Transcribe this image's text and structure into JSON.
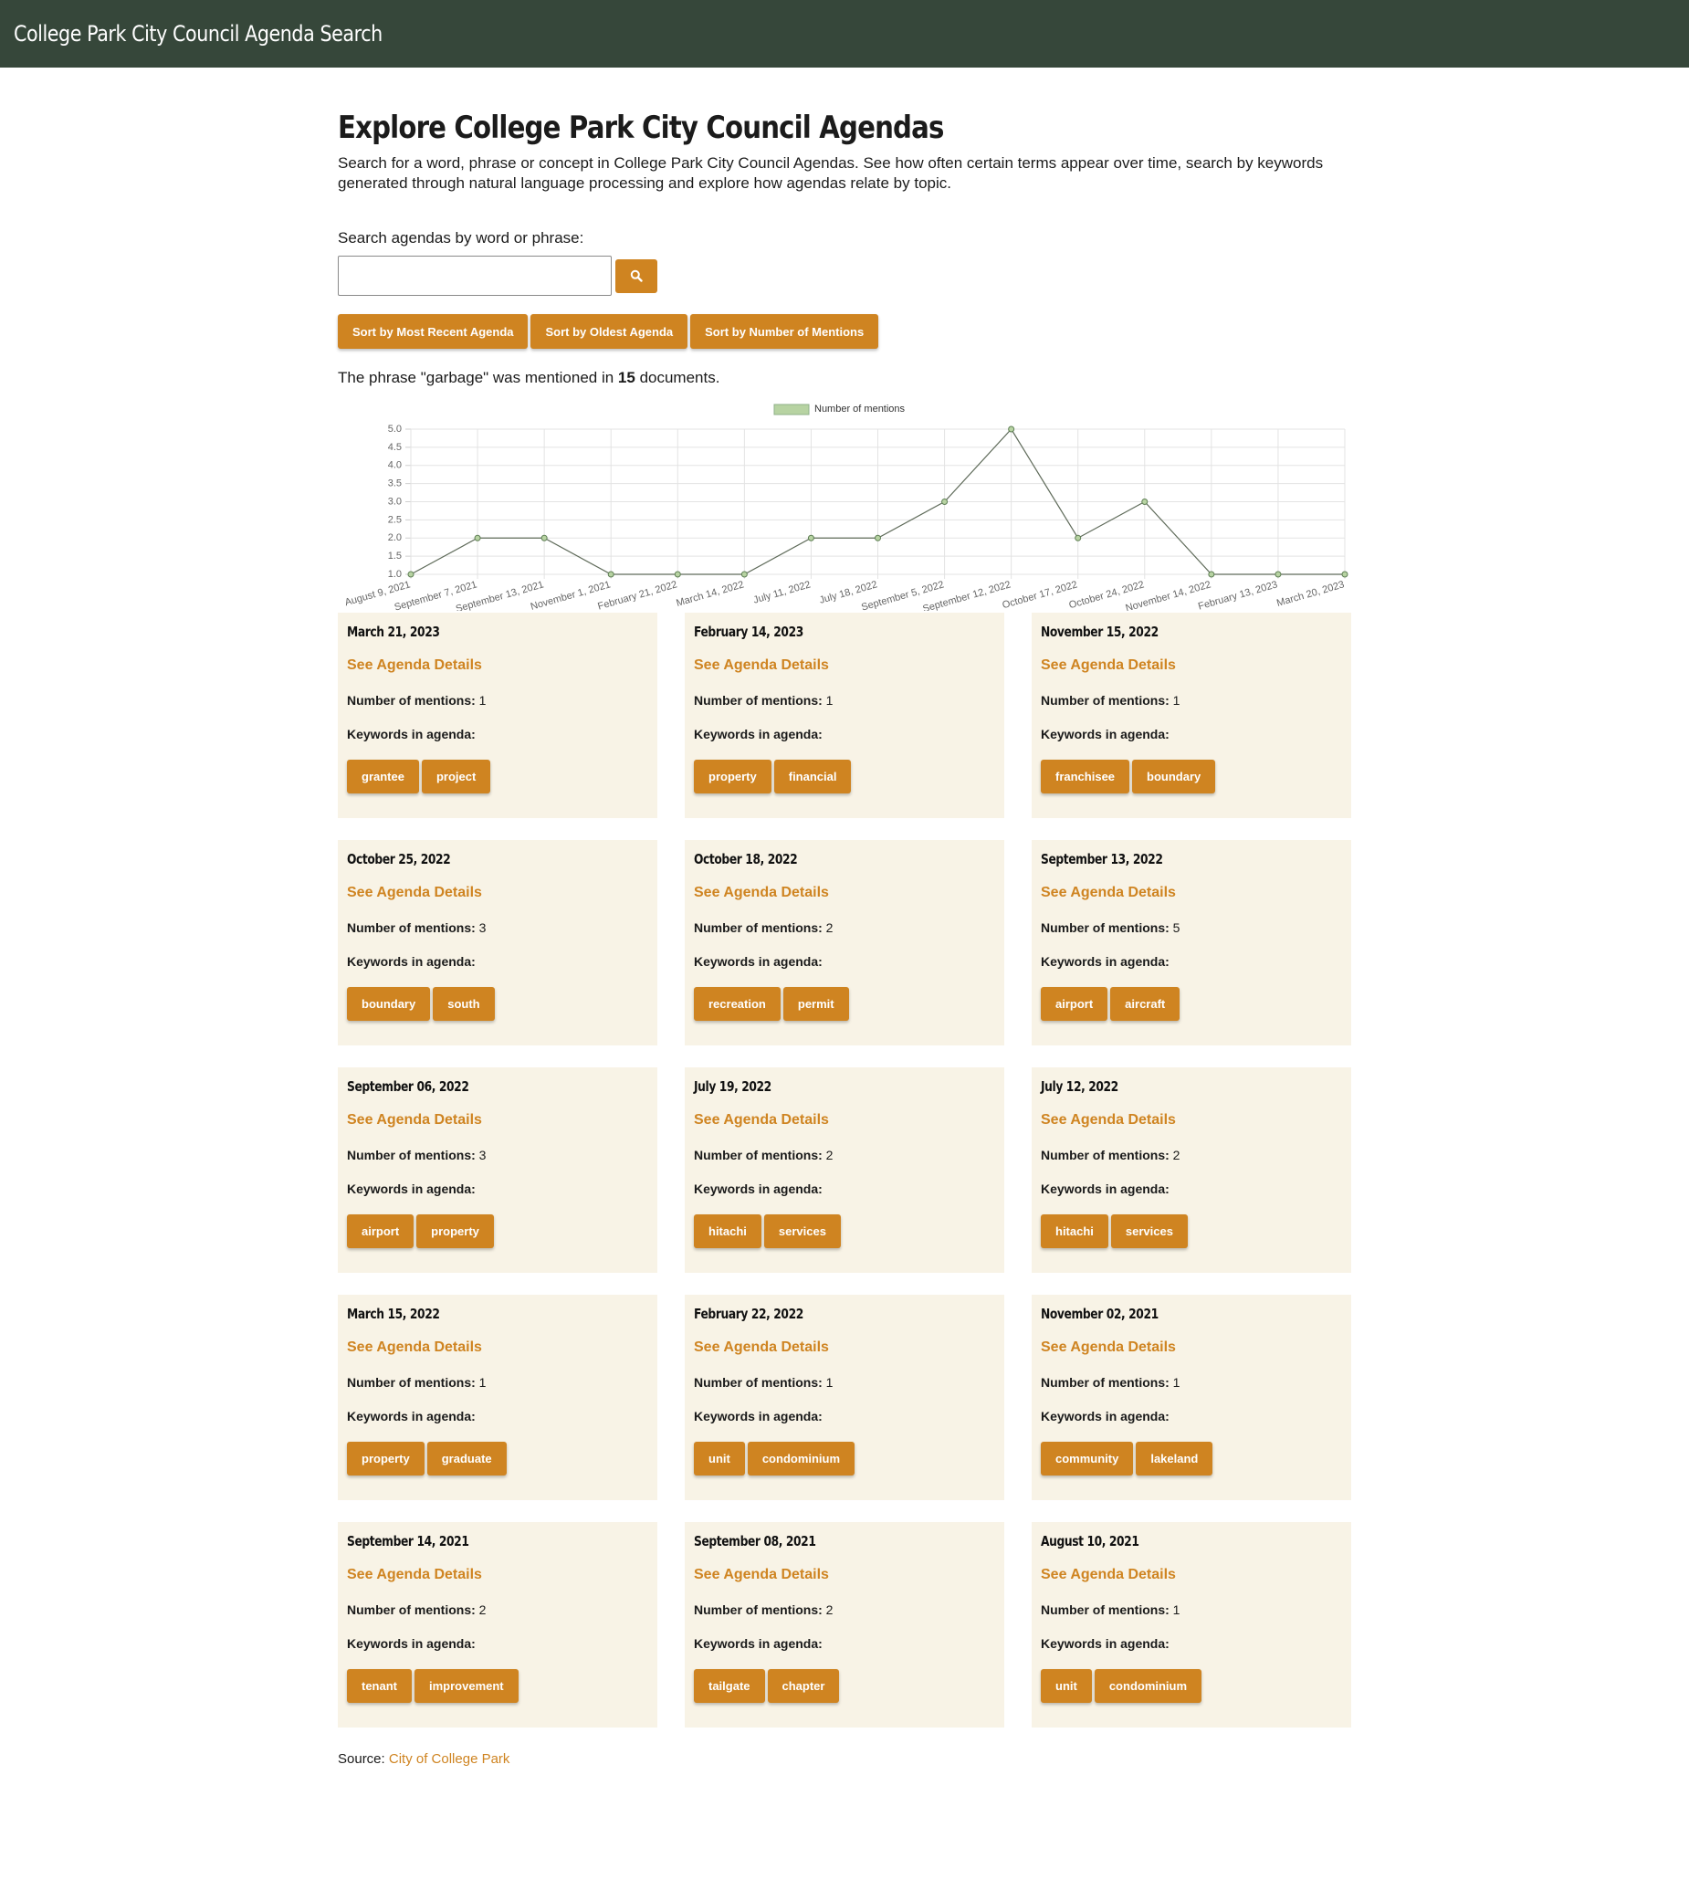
{
  "header": {
    "title": "College Park City Council Agenda Search"
  },
  "main": {
    "title": "Explore College Park City Council Agendas",
    "intro": "Search for a word, phrase or concept in College Park City Council Agendas. See how often certain terms appear over time, search by keywords generated through natural language processing and explore how agendas relate by topic.",
    "search": {
      "label": "Search agendas by word or phrase:",
      "value": "",
      "button_icon": "search-icon"
    },
    "sort_buttons": [
      "Sort by Most Recent Agenda",
      "Sort by Oldest Agenda",
      "Sort by Number of Mentions"
    ],
    "summary": {
      "prefix": "The phrase \"garbage\" was mentioned in ",
      "count": "15",
      "suffix": " documents."
    }
  },
  "colors": {
    "accent": "#cf8421",
    "header_bg": "#36473a",
    "card_bg": "#f8f3e6",
    "legend_fill": "#b7d3a2",
    "line": "#5f6b5a"
  },
  "chart_data": {
    "type": "line",
    "legend": "Number of mentions",
    "legend_position": "top",
    "grid": true,
    "ylim": [
      1.0,
      5.0
    ],
    "yticks": [
      "1.0",
      "1.5",
      "2.0",
      "2.5",
      "3.0",
      "3.5",
      "4.0",
      "4.5",
      "5.0"
    ],
    "x": [
      "August 9, 2021",
      "September 7, 2021",
      "September 13, 2021",
      "November 1, 2021",
      "February 21, 2022",
      "March 14, 2022",
      "July 11, 2022",
      "July 18, 2022",
      "September 5, 2022",
      "September 12, 2022",
      "October 17, 2022",
      "October 24, 2022",
      "November 14, 2022",
      "February 13, 2023",
      "March 20, 2023"
    ],
    "series": [
      {
        "name": "Number of mentions",
        "values": [
          1,
          2,
          2,
          1,
          1,
          1,
          2,
          2,
          3,
          5,
          2,
          3,
          1,
          1,
          1
        ]
      }
    ]
  },
  "cards_common": {
    "link_label": "See Agenda Details",
    "mentions_label": "Number of mentions:",
    "keywords_label": "Keywords in agenda:"
  },
  "cards": [
    {
      "date": "March 21, 2023",
      "mentions": "1",
      "keywords": [
        "grantee",
        "project"
      ]
    },
    {
      "date": "February 14, 2023",
      "mentions": "1",
      "keywords": [
        "property",
        "financial"
      ]
    },
    {
      "date": "November 15, 2022",
      "mentions": "1",
      "keywords": [
        "franchisee",
        "boundary"
      ]
    },
    {
      "date": "October 25, 2022",
      "mentions": "3",
      "keywords": [
        "boundary",
        "south"
      ]
    },
    {
      "date": "October 18, 2022",
      "mentions": "2",
      "keywords": [
        "recreation",
        "permit"
      ]
    },
    {
      "date": "September 13, 2022",
      "mentions": "5",
      "keywords": [
        "airport",
        "aircraft"
      ]
    },
    {
      "date": "September 06, 2022",
      "mentions": "3",
      "keywords": [
        "airport",
        "property"
      ]
    },
    {
      "date": "July 19, 2022",
      "mentions": "2",
      "keywords": [
        "hitachi",
        "services"
      ]
    },
    {
      "date": "July 12, 2022",
      "mentions": "2",
      "keywords": [
        "hitachi",
        "services"
      ]
    },
    {
      "date": "March 15, 2022",
      "mentions": "1",
      "keywords": [
        "property",
        "graduate"
      ]
    },
    {
      "date": "February 22, 2022",
      "mentions": "1",
      "keywords": [
        "unit",
        "condominium"
      ]
    },
    {
      "date": "November 02, 2021",
      "mentions": "1",
      "keywords": [
        "community",
        "lakeland"
      ]
    },
    {
      "date": "September 14, 2021",
      "mentions": "2",
      "keywords": [
        "tenant",
        "improvement"
      ]
    },
    {
      "date": "September 08, 2021",
      "mentions": "2",
      "keywords": [
        "tailgate",
        "chapter"
      ]
    },
    {
      "date": "August 10, 2021",
      "mentions": "1",
      "keywords": [
        "unit",
        "condominium"
      ]
    }
  ],
  "footer": {
    "source_label": "Source:",
    "source_link": "City of College Park"
  }
}
